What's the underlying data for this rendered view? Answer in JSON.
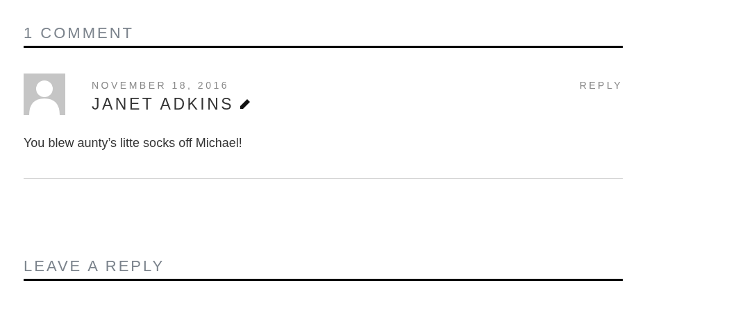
{
  "comments_heading": "1 COMMENT",
  "comments": [
    {
      "date": "NOVEMBER 18, 2016",
      "author": "JANET ADKINS",
      "reply": "REPLY",
      "text": "You blew aunty’s litte socks off Michael!"
    }
  ],
  "reply_heading": "LEAVE A REPLY"
}
